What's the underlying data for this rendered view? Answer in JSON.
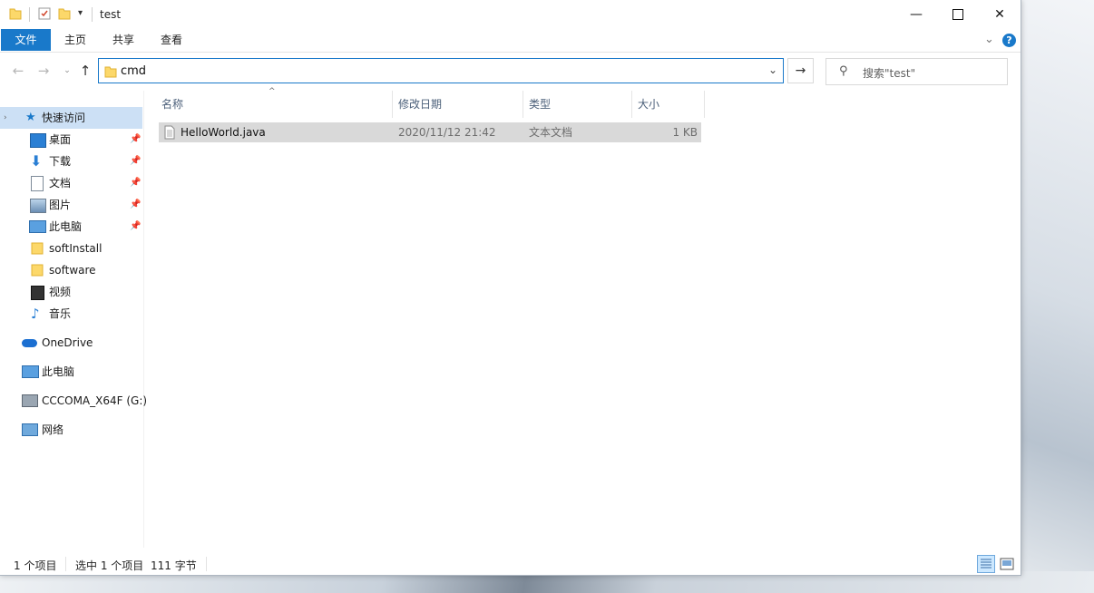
{
  "window": {
    "title": "test"
  },
  "ribbon": {
    "tabs": [
      "文件",
      "主页",
      "共享",
      "查看"
    ],
    "expand_icon": "chevron-down-icon",
    "help_icon": "help-icon",
    "help_label": "?"
  },
  "address": {
    "path": "cmd"
  },
  "search": {
    "placeholder": "搜索\"test\""
  },
  "nav": {
    "quick_access": "快速访问",
    "pinned": [
      "桌面",
      "下载",
      "文档",
      "图片",
      "此电脑"
    ],
    "recent": [
      "softInstall",
      "software",
      "视频",
      "音乐"
    ],
    "onedrive": "OneDrive",
    "thispc": "此电脑",
    "drive": "CCCOMA_X64F (G:)",
    "network": "网络"
  },
  "columns": [
    "名称",
    "修改日期",
    "类型",
    "大小"
  ],
  "files": [
    {
      "name": "HelloWorld.java",
      "modified": "2020/11/12 21:42",
      "type": "文本文档",
      "size": "1 KB"
    }
  ],
  "status": {
    "count": "1 个项目",
    "selected": "选中 1 个项目",
    "size": "111 字节"
  },
  "colors": {
    "accent": "#1979ca",
    "selection": "#cce0f5",
    "row_selected": "#d9d9d9"
  }
}
